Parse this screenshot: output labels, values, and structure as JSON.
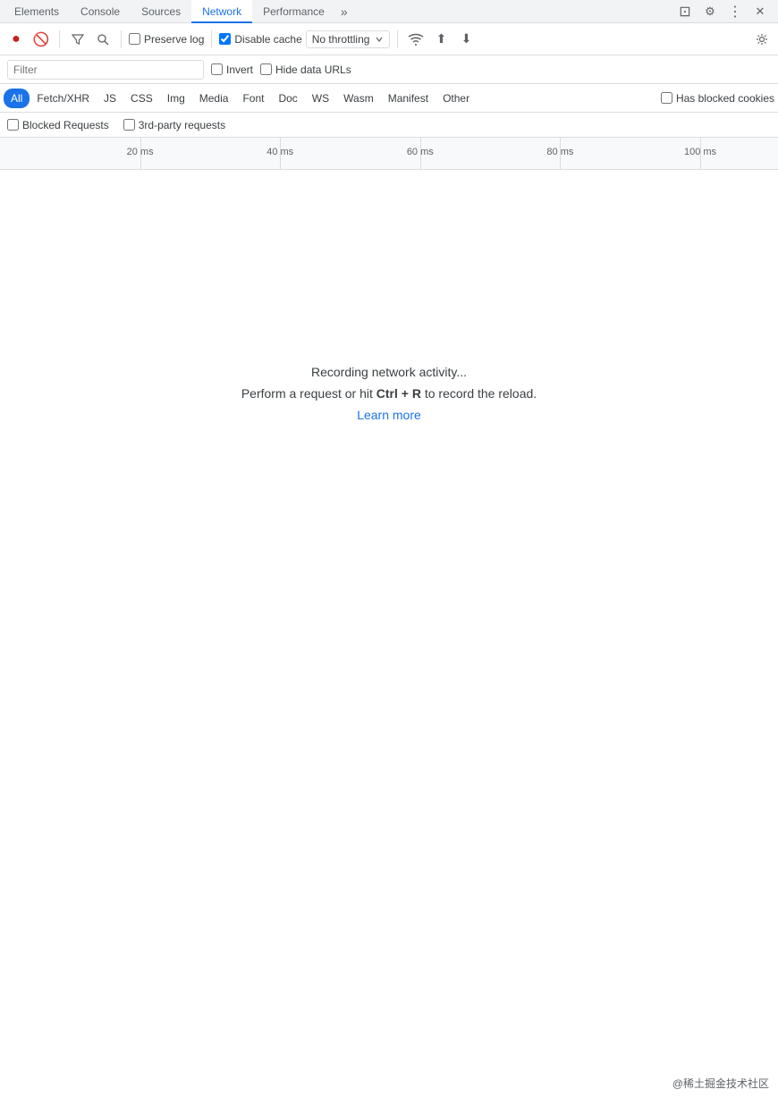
{
  "tabs": [
    {
      "id": "elements",
      "label": "Elements",
      "active": false
    },
    {
      "id": "console",
      "label": "Console",
      "active": false
    },
    {
      "id": "sources",
      "label": "Sources",
      "active": false
    },
    {
      "id": "network",
      "label": "Network",
      "active": true
    },
    {
      "id": "performance",
      "label": "Performance",
      "active": false
    }
  ],
  "tab_more_label": "»",
  "right_icons": {
    "dock": "⊡",
    "settings": "⚙",
    "more": "⋮",
    "close": "✕"
  },
  "toolbar": {
    "record_icon": "⏺",
    "clear_icon": "🚫",
    "filter_icon": "⊟",
    "search_icon": "🔍",
    "preserve_log_label": "Preserve log",
    "preserve_log_checked": false,
    "disable_cache_label": "Disable cache",
    "disable_cache_checked": true,
    "throttle_label": "No throttling",
    "wifi_icon": "📶",
    "upload_icon": "⬆",
    "download_icon": "⬇",
    "settings_icon": "⚙"
  },
  "filter": {
    "placeholder": "Filter",
    "invert_label": "Invert",
    "invert_checked": false,
    "hide_data_urls_label": "Hide data URLs",
    "hide_data_urls_checked": false
  },
  "type_filters": [
    {
      "id": "all",
      "label": "All",
      "active": true
    },
    {
      "id": "fetch-xhr",
      "label": "Fetch/XHR",
      "active": false
    },
    {
      "id": "js",
      "label": "JS",
      "active": false
    },
    {
      "id": "css",
      "label": "CSS",
      "active": false
    },
    {
      "id": "img",
      "label": "Img",
      "active": false
    },
    {
      "id": "media",
      "label": "Media",
      "active": false
    },
    {
      "id": "font",
      "label": "Font",
      "active": false
    },
    {
      "id": "doc",
      "label": "Doc",
      "active": false
    },
    {
      "id": "ws",
      "label": "WS",
      "active": false
    },
    {
      "id": "wasm",
      "label": "Wasm",
      "active": false
    },
    {
      "id": "manifest",
      "label": "Manifest",
      "active": false
    },
    {
      "id": "other",
      "label": "Other",
      "active": false
    }
  ],
  "has_blocked_cookies_label": "Has blocked cookies",
  "has_blocked_cookies_checked": false,
  "extra_filters": [
    {
      "id": "blocked-requests",
      "label": "Blocked Requests",
      "checked": false
    },
    {
      "id": "third-party",
      "label": "3rd-party requests",
      "checked": false
    }
  ],
  "timeline": {
    "ticks": [
      {
        "label": "20 ms",
        "left_pct": 18
      },
      {
        "label": "40 ms",
        "left_pct": 36
      },
      {
        "label": "60 ms",
        "left_pct": 54
      },
      {
        "label": "80 ms",
        "left_pct": 72
      },
      {
        "label": "100 ms",
        "left_pct": 90
      }
    ]
  },
  "empty_state": {
    "title": "Recording network activity...",
    "description_before": "Perform a request or hit ",
    "description_shortcut": "Ctrl + R",
    "description_after": " to record the reload.",
    "learn_more_label": "Learn more"
  },
  "watermark": "@稀土掘金技术社区"
}
